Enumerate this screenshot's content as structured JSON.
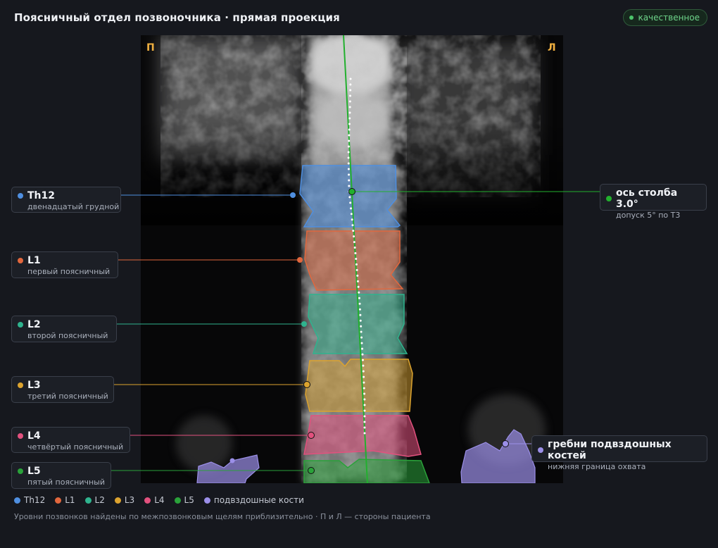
{
  "header": {
    "title": "Поясничный отдел позвоночника · прямая проекция",
    "quality_badge": "качественное"
  },
  "image": {
    "side_left": "П",
    "side_right": "Л"
  },
  "levels": [
    {
      "id": "th12",
      "name": "Th12",
      "desc": "двенадцатый грудной",
      "color": "#4f8fe0"
    },
    {
      "id": "l1",
      "name": "L1",
      "desc": "первый поясничный",
      "color": "#e2673d"
    },
    {
      "id": "l2",
      "name": "L2",
      "desc": "второй поясничный",
      "color": "#2fb38e"
    },
    {
      "id": "l3",
      "name": "L3",
      "desc": "третий поясничный",
      "color": "#dca32f"
    },
    {
      "id": "l4",
      "name": "L4",
      "desc": "четвёртый поясничный",
      "color": "#e2517e"
    },
    {
      "id": "l5",
      "name": "L5",
      "desc": "пятый поясничный",
      "color": "#2aa23a"
    }
  ],
  "axis": {
    "title": "ось столба 3.0°",
    "desc": "допуск 5° по Т3",
    "color": "#22b02e"
  },
  "iliac": {
    "title": "гребни подвздошных костей",
    "desc": "нижняя граница охвата",
    "color": "#9b8fe8"
  },
  "legend": [
    {
      "label": "Th12",
      "color": "#4f8fe0"
    },
    {
      "label": "L1",
      "color": "#e2673d"
    },
    {
      "label": "L2",
      "color": "#2fb38e"
    },
    {
      "label": "L3",
      "color": "#dca32f"
    },
    {
      "label": "L4",
      "color": "#e2517e"
    },
    {
      "label": "L5",
      "color": "#2aa23a"
    },
    {
      "label": "подвздошные кости",
      "color": "#9b8fe8"
    }
  ],
  "footer": {
    "note": "Уровни позвонков найдены по межпозвонковым щелям приблизительно · П и Л — стороны пациента"
  }
}
